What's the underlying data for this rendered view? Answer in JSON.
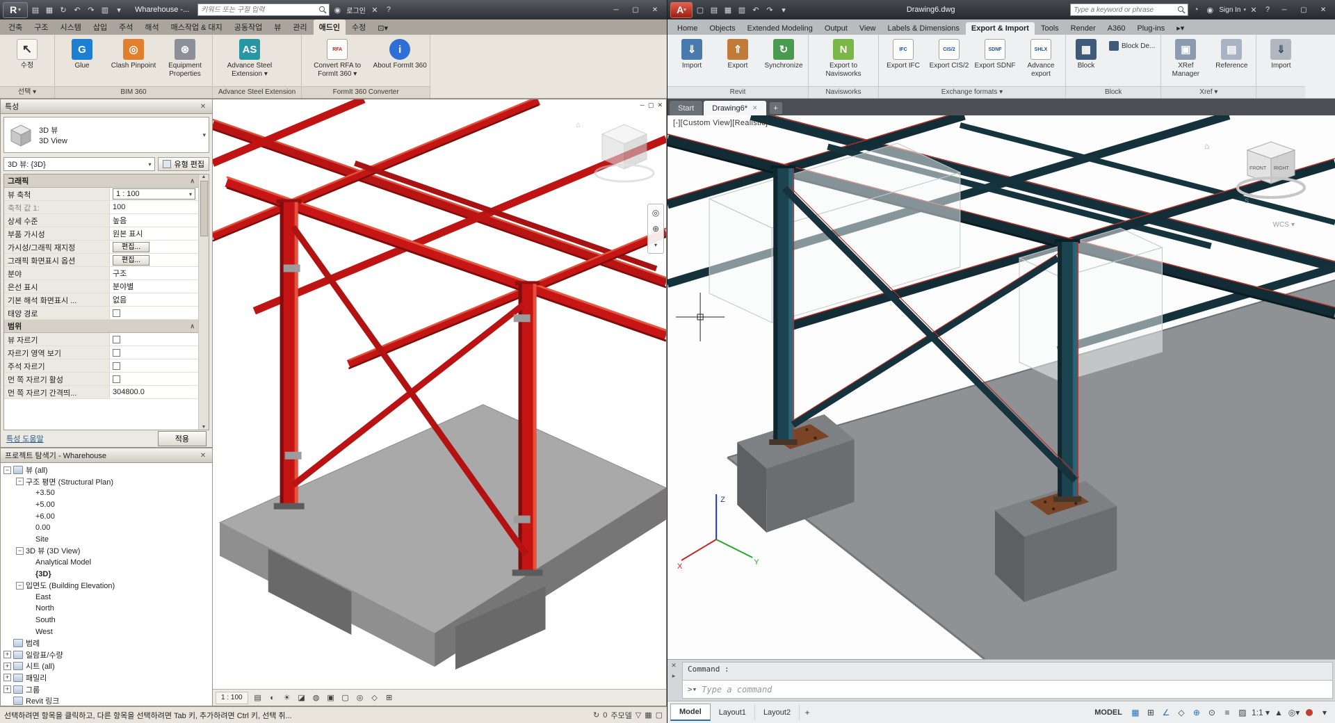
{
  "revit": {
    "titlebar": {
      "title": "Wharehouse -...",
      "search_placeholder": "키워드 또는 구절 입력",
      "login_label": "로그인"
    },
    "tabs": [
      "건축",
      "구조",
      "시스템",
      "삽입",
      "주석",
      "해석",
      "매스작업 & 대지",
      "공동작업",
      "뷰",
      "관리",
      "애드인",
      "수정"
    ],
    "ribbon": {
      "modify_button": "수정",
      "select_panel": "선택",
      "buttons": [
        "Glue",
        "Clash Pinpoint",
        "Equipment Properties",
        "Advance Steel Extension",
        "Convert RFA to FormIt 360",
        "About FormIt 360"
      ],
      "panel_labels": [
        "BIM 360",
        "Advance Steel Extension",
        "FormIt 360 Converter"
      ]
    },
    "properties": {
      "header": "특성",
      "type_name": "3D 뷰",
      "type_desc": "3D View",
      "selector": "3D 뷰: {3D}",
      "edit_type": "유형 편집",
      "group_graphics": "그래픽",
      "group_extents": "범위",
      "rows": [
        {
          "label": "뷰 축척",
          "value": "1 : 100"
        },
        {
          "label": "축척 값    1:",
          "value": "100"
        },
        {
          "label": "상세 수준",
          "value": "높음"
        },
        {
          "label": "부품 가시성",
          "value": "원본 표시"
        },
        {
          "label": "가시성/그래픽 재지정",
          "value": "편집..."
        },
        {
          "label": "그래픽 화면표시 옵션",
          "value": "편집..."
        },
        {
          "label": "분야",
          "value": "구조"
        },
        {
          "label": "은선 표시",
          "value": "분야별"
        },
        {
          "label": "기본 해석 화면표시 ...",
          "value": "없음"
        },
        {
          "label": "태양 경로",
          "value": ""
        },
        {
          "label": "뷰 자르기",
          "value": ""
        },
        {
          "label": "자르기 영역 보기",
          "value": ""
        },
        {
          "label": "주석 자르기",
          "value": ""
        },
        {
          "label": "먼 쪽 자르기 활성",
          "value": ""
        },
        {
          "label": "먼 쪽 자르기 간격띄...",
          "value": "304800.0"
        }
      ],
      "help_link": "특성 도움말",
      "apply_button": "적용"
    },
    "browser": {
      "header": "프로젝트 탐색기 - Wharehouse",
      "nodes": [
        "뷰 (all)",
        "구조 평면 (Structural Plan)",
        "+3.50",
        "+5.00",
        "+6.00",
        "0.00",
        "Site",
        "3D 뷰 (3D View)",
        "Analytical Model",
        "{3D}",
        "입면도 (Building Elevation)",
        "East",
        "North",
        "South",
        "West",
        "범례",
        "일람표/수량",
        "시트 (all)",
        "패밀리",
        "그룹",
        "Revit 링크"
      ]
    },
    "view_control": {
      "scale": "1 : 100"
    },
    "statusbar": {
      "hint": "선택하려면 항목을 클릭하고, 다른 항목을 선택하려면 Tab 키, 추가하려면 Ctrl 키, 선택 취...",
      "count": "0",
      "main_model": "주모델"
    }
  },
  "autocad": {
    "titlebar": {
      "title": "Drawing6.dwg",
      "search_placeholder": "Type a keyword or phrase",
      "signin_label": "Sign In"
    },
    "tabs": [
      "Home",
      "Objects",
      "Extended Modeling",
      "Output",
      "View",
      "Labels & Dimensions",
      "Export & Import",
      "Tools",
      "Render",
      "A360",
      "Plug-ins"
    ],
    "ribbon": {
      "buttons": [
        "Import",
        "Export",
        "Synchronize",
        "Export to Navisworks",
        "Export IFC",
        "Export CIS/2",
        "Export SDNF",
        "Advance export",
        "Block",
        "Block De...",
        "XRef Manager",
        "Reference",
        "Import"
      ],
      "badges": [
        "IFC",
        "CIS/2",
        "SDNF",
        "SHLX"
      ],
      "panel_labels": [
        "Revit",
        "Navisworks",
        "Exchange formats",
        "Block",
        "Xref"
      ]
    },
    "file_tabs": [
      "Start",
      "Drawing6*"
    ],
    "viewport": {
      "label": "[-][Custom View][Realistic]",
      "viewcube_front": "FRONT",
      "viewcube_right": "RIGHT",
      "compass_south": "S",
      "wcs": "WCS"
    },
    "command": {
      "history": "Command :",
      "prompt": "Type a command"
    },
    "layout_tabs": [
      "Model",
      "Layout1",
      "Layout2"
    ],
    "statusbar": {
      "model": "MODEL",
      "scale": "1:1"
    }
  }
}
